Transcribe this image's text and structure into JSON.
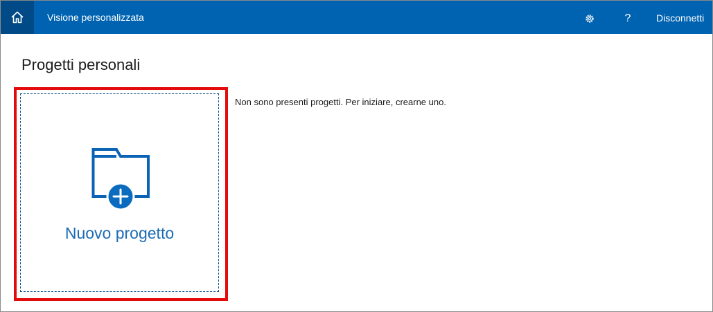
{
  "header": {
    "home_icon": "home-icon",
    "title": "Visione personalizzata",
    "settings_icon": "gear-icon",
    "help_label": "?",
    "signout_label": "Disconnetti",
    "background_color": "#0063b1",
    "home_background_color": "#004b87"
  },
  "main": {
    "page_title": "Progetti personali",
    "new_project_label": "Nuovo progetto",
    "new_project_icon": "folder-add-icon",
    "empty_message": "Non sono presenti progetti. Per iniziare, crearne uno.",
    "highlight_color": "#e30b0b",
    "accent_color": "#0a6bbf"
  }
}
